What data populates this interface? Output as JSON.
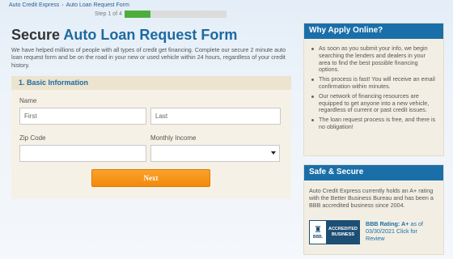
{
  "breadcrumb": {
    "home": "Auto Credit Express",
    "current": "Auto Loan Request Form"
  },
  "progress": {
    "label": "Step 1 of 4",
    "fraction": 0.25,
    "color": "#4cae3d"
  },
  "title": {
    "prefix": "Secure ",
    "accent": "Auto Loan Request Form"
  },
  "intro": "We have helped millions of people with all types of credit get financing. Complete our secure 2 minute auto loan request form and be on the road in your new or used vehicle within 24 hours, regardless of your credit history.",
  "form": {
    "section_title": "1. Basic Information",
    "name_label": "Name",
    "first_placeholder": "First",
    "last_placeholder": "Last",
    "zip_label": "Zip Code",
    "zip_value": "",
    "income_label": "Monthly Income",
    "income_selected": "",
    "next_label": "Next"
  },
  "why": {
    "title": "Why Apply Online?",
    "items": [
      "As soon as you submit your info, we begin searching the lenders and dealers in your area to find the best possible financing options.",
      "This process is fast! You will receive an email confirmation within minutes.",
      "Our network of financing resources are equipped to get anyone into a new vehicle, regardless of current or past credit issues.",
      "The loan request process is free, and there is no obligation!"
    ]
  },
  "safe": {
    "title": "Safe & Secure",
    "text": "Auto Credit Express currently holds an A+ rating with the Better Business Bureau and has been a BBB accredited business since 2004.",
    "seal_bbb": "BBB.",
    "seal_line1": "ACCREDITED",
    "seal_line2": "BUSINESS",
    "rating_label": "BBB Rating: A+",
    "rating_date": " as of 03/30/2021 Click for Review"
  },
  "colors": {
    "accent": "#1d6aa0",
    "header_blue": "#1a6fa9",
    "button_orange": "#f28a0d"
  }
}
